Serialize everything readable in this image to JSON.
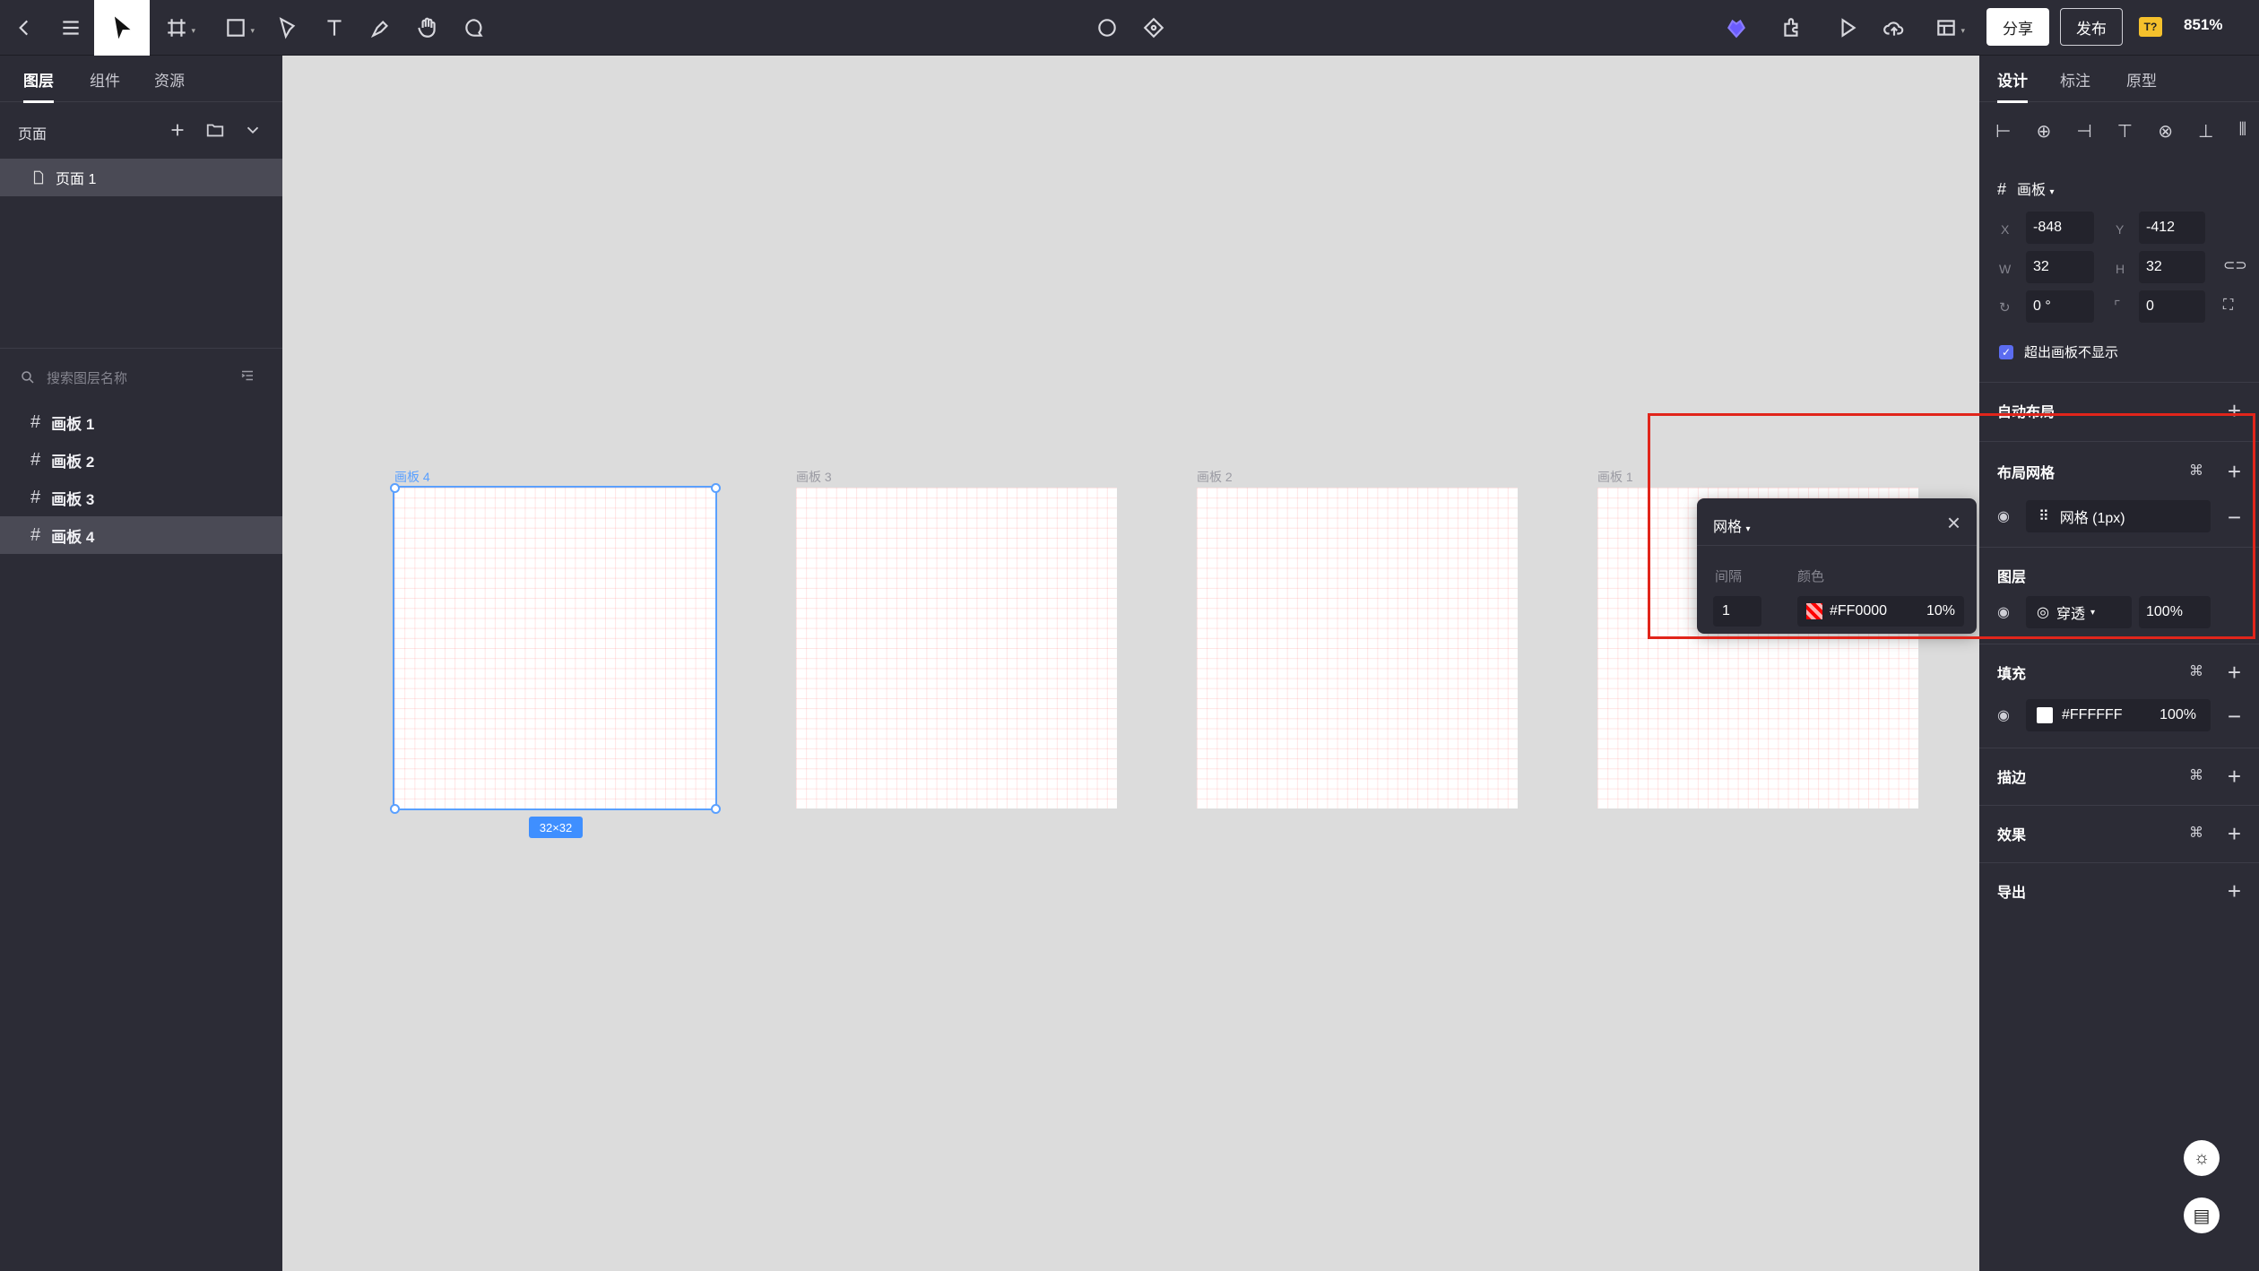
{
  "toolbar": {
    "share_label": "分享",
    "publish_label": "发布",
    "badge_text": "T?",
    "zoom": "851%"
  },
  "left_panel": {
    "tabs": [
      "图层",
      "组件",
      "资源"
    ],
    "pages_header": "页面",
    "pages": [
      "页面 1"
    ],
    "search_placeholder": "搜索图层名称",
    "layers": [
      "画板 1",
      "画板 2",
      "画板 3",
      "画板 4"
    ],
    "selected_layer": "画板 4"
  },
  "canvas": {
    "boards": [
      {
        "label": "画板 4",
        "selected": true
      },
      {
        "label": "画板 3",
        "selected": false
      },
      {
        "label": "画板 2",
        "selected": false
      },
      {
        "label": "画板 1",
        "selected": false
      }
    ],
    "dimension_badge": "32×32"
  },
  "grid_popup": {
    "title": "网格",
    "spacing_label": "间隔",
    "color_label": "颜色",
    "spacing_value": "1",
    "color_hex": "#FF0000",
    "opacity": "10%"
  },
  "right_panel": {
    "tabs": [
      "设计",
      "标注",
      "原型"
    ],
    "frame_type": "画板",
    "x_label": "X",
    "x": "-848",
    "y_label": "Y",
    "y": "-412",
    "w_label": "W",
    "w": "32",
    "h_label": "H",
    "h": "32",
    "rotation": "0 °",
    "radius": "0",
    "clip_label": "超出画板不显示",
    "sections": {
      "auto_layout": "自动布局",
      "layout_grid": "布局网格",
      "layer": "图层",
      "fill": "填充",
      "stroke": "描边",
      "effects": "效果",
      "export": "导出"
    },
    "layout_grid_item": "网格 (1px)",
    "layer_blend": "穿透",
    "layer_opacity": "100%",
    "fill_hex": "#FFFFFF",
    "fill_opacity": "100%"
  },
  "colors": {
    "accent": "#5b6cf0",
    "selection": "#3f8fff",
    "highlight_box": "#e1251b",
    "grid_color": "#FF0000"
  }
}
